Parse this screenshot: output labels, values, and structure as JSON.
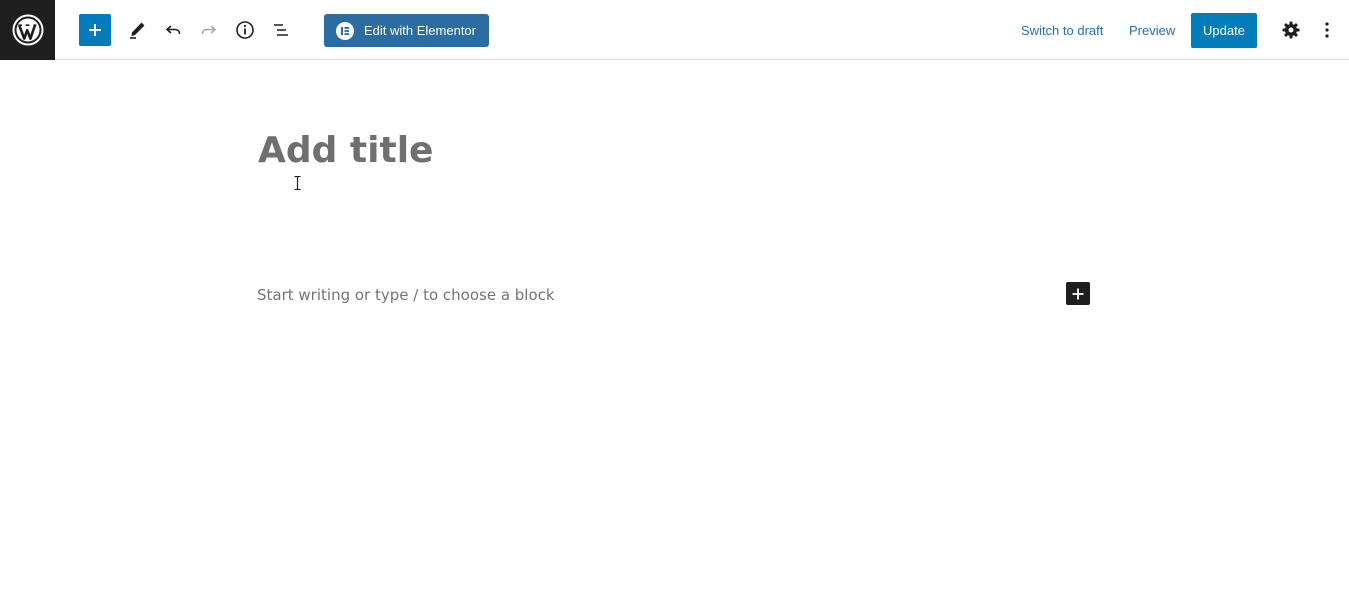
{
  "toolbar": {
    "logo_icon": "wordpress-logo-icon",
    "add_block_icon": "plus-icon",
    "tools_icon": "pencil-icon",
    "undo_icon": "undo-icon",
    "redo_icon": "redo-icon",
    "details_icon": "info-icon",
    "outline_icon": "list-view-icon",
    "elementor_label": "Edit with Elementor",
    "elementor_icon": "elementor-icon",
    "switch_to_draft_label": "Switch to draft",
    "preview_label": "Preview",
    "update_label": "Update",
    "settings_icon": "gear-icon",
    "more_icon": "vertical-ellipsis-icon",
    "colors": {
      "primary": "#007cba",
      "elementor": "#2b6ca3",
      "link": "#2271b1",
      "logo_bg": "#1e1e1e"
    }
  },
  "editor": {
    "title_placeholder": "Add title",
    "block_placeholder": "Start writing or type / to choose a block",
    "inserter_icon": "plus-icon"
  }
}
